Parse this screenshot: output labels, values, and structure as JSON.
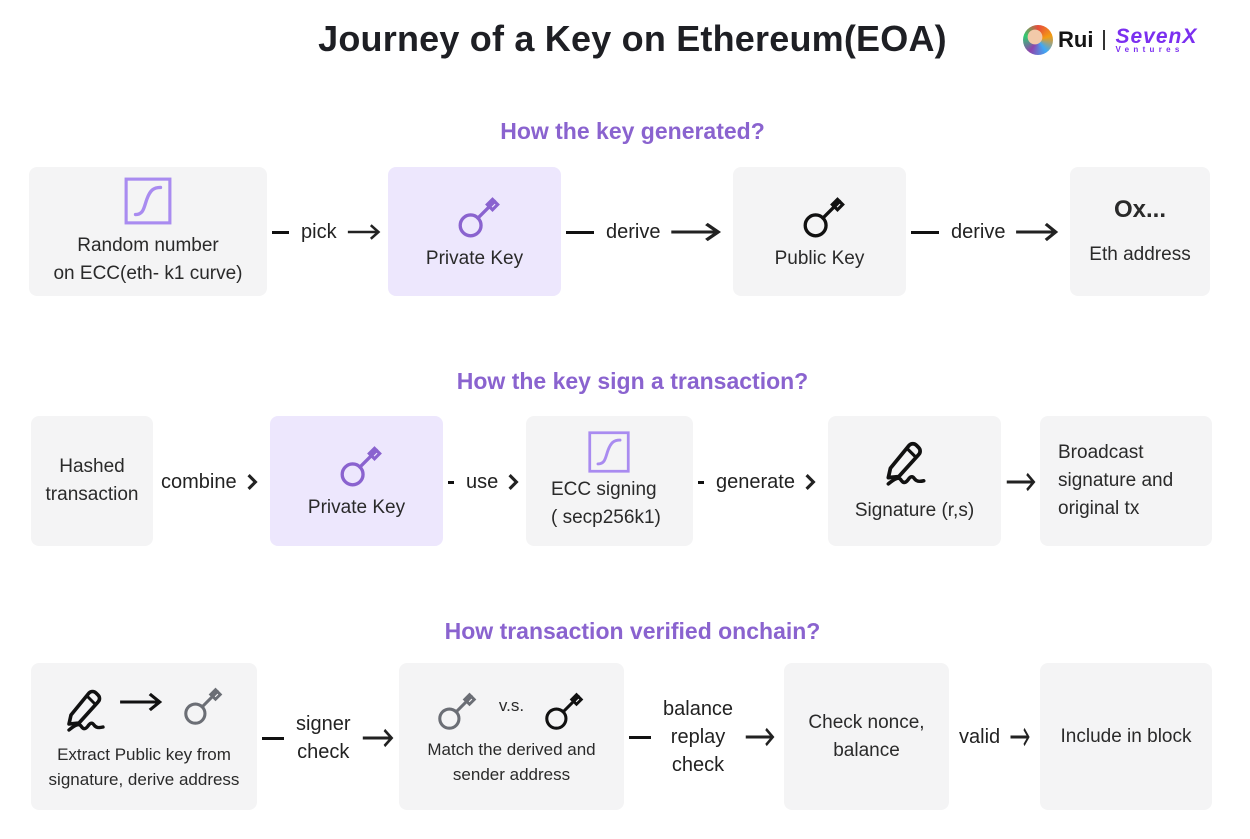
{
  "title": "Journey of a Key on Ethereum(EOA)",
  "brand": {
    "author": "Rui",
    "logo_main": "SevenX",
    "logo_sub": "Ventures",
    "logo_color": "#7b2ff0"
  },
  "colors": {
    "accent": "#8a63cf",
    "box_gray": "#f4f4f5",
    "box_purple": "#ede7fd",
    "icon_purple": "#8a63cf",
    "icon_gray": "#6b6e75"
  },
  "sections": [
    {
      "title": "How the key generated?",
      "nodes": [
        {
          "icon": "curve-icon",
          "lines": [
            "Random number",
            "on ECC(eth- k1 curve)"
          ]
        },
        {
          "icon": "key-icon",
          "lines": [
            "Private Key"
          ],
          "highlight": true
        },
        {
          "icon": "key-icon",
          "lines": [
            "Public Key"
          ]
        },
        {
          "heading": "Ox...",
          "lines": [
            "Eth address"
          ]
        }
      ],
      "connectors": [
        "pick",
        "derive",
        "derive"
      ]
    },
    {
      "title": "How the key sign a transaction?",
      "nodes": [
        {
          "lines": [
            "Hashed",
            "transaction"
          ]
        },
        {
          "icon": "key-icon",
          "lines": [
            "Private Key"
          ],
          "highlight": true
        },
        {
          "icon": "curve-icon",
          "lines": [
            "ECC signing",
            "( secp256k1)"
          ]
        },
        {
          "icon": "signature-pen-icon",
          "lines": [
            "Signature (r,s)"
          ]
        },
        {
          "lines": [
            "Broadcast",
            "signature and",
            "original tx"
          ]
        }
      ],
      "connectors": [
        "combine",
        "use",
        "generate",
        ""
      ]
    },
    {
      "title": "How transaction verified onchain?",
      "nodes": [
        {
          "icons": [
            "signature-pen-icon",
            "arrow-right-icon",
            "key-icon"
          ],
          "lines": [
            "Extract Public key from",
            "signature, derive address"
          ]
        },
        {
          "icons": [
            "key-icon",
            "key-icon"
          ],
          "vs": "v.s.",
          "lines": [
            "Match the derived and",
            "sender address"
          ]
        },
        {
          "lines": [
            "Check nonce,",
            "balance"
          ]
        },
        {
          "lines": [
            "Include in block"
          ]
        }
      ],
      "connectors": [
        [
          "signer",
          "check"
        ],
        [
          "balance",
          "replay",
          "check"
        ],
        [
          "valid"
        ]
      ]
    }
  ]
}
